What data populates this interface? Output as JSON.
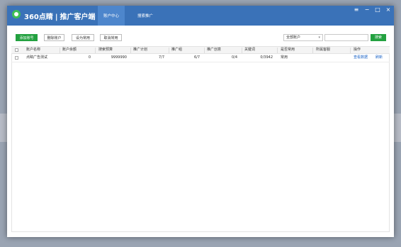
{
  "app": {
    "logo_text": "360点睛",
    "title": "推广客户端"
  },
  "tabs": [
    {
      "label": "账户中心"
    },
    {
      "label": "搜索推广"
    }
  ],
  "window_controls": [
    "≡",
    "−",
    "□",
    "×"
  ],
  "toolbar": {
    "add_account": "添加账号",
    "delete_account": "删除账户",
    "set_common": "设为常用",
    "cancel_common": "取消常用"
  },
  "filter": {
    "select_value": "全部账户",
    "search_placeholder": "",
    "search_button": "搜索"
  },
  "table": {
    "headers": [
      "账户名称",
      "账户余额",
      "搜索预算",
      "推广计划",
      "推广组",
      "推广创意",
      "关键词",
      "是否常用",
      "所属客服",
      "操作"
    ],
    "rows": [
      {
        "name": "点睛广告测试",
        "balance": "0",
        "budget": "9999990",
        "plans": "7/7",
        "groups": "6/7",
        "creatives": "0/4",
        "keywords": "0/3942",
        "is_common": "常用",
        "service": "",
        "action_view": "查看数据",
        "action_refresh": "刷新"
      }
    ]
  }
}
